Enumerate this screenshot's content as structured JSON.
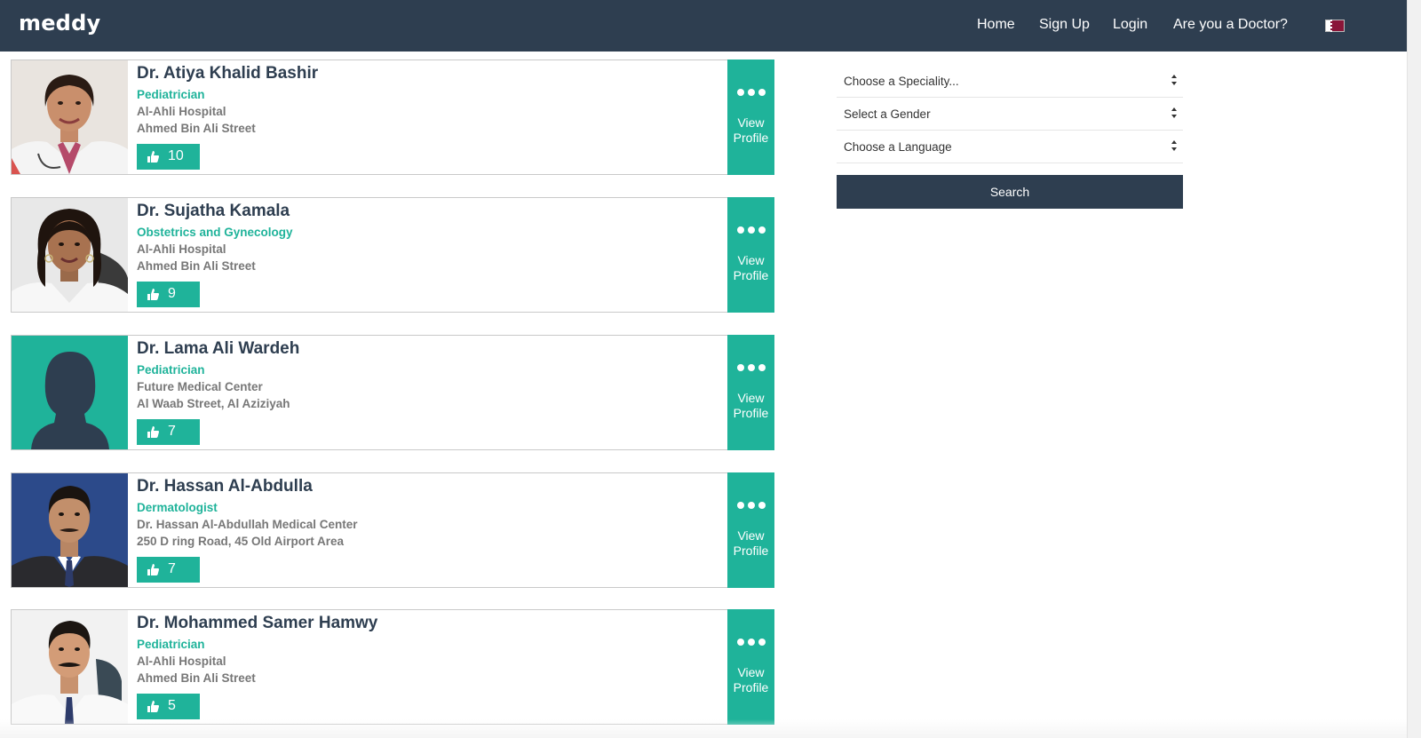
{
  "app": {
    "logo": "meddy"
  },
  "nav": {
    "links": [
      "Home",
      "Sign Up",
      "Login",
      "Are you a Doctor?"
    ],
    "flag": "qatar-flag"
  },
  "doctors": [
    {
      "name": "Dr. Atiya Khalid Bashir",
      "speciality": "Pediatrician",
      "hospital": "Al-Ahli Hospital",
      "address": "Ahmed Bin Ali Street",
      "likes": "10",
      "photo": "female-doctor-photo",
      "view_label_1": "View",
      "view_label_2": "Profile"
    },
    {
      "name": "Dr. Sujatha Kamala",
      "speciality": "Obstetrics and Gynecology",
      "hospital": "Al-Ahli Hospital",
      "address": "Ahmed Bin Ali Street",
      "likes": "9",
      "photo": "female-doctor-photo",
      "view_label_1": "View",
      "view_label_2": "Profile"
    },
    {
      "name": "Dr. Lama Ali Wardeh",
      "speciality": "Pediatrician",
      "hospital": "Future Medical Center",
      "address": "Al Waab Street, Al Aziziyah",
      "likes": "7",
      "photo": "female-silhouette-placeholder",
      "view_label_1": "View",
      "view_label_2": "Profile"
    },
    {
      "name": "Dr. Hassan Al-Abdulla",
      "speciality": "Dermatologist",
      "hospital": "Dr. Hassan Al-Abdullah Medical Center",
      "address": "250 D ring Road, 45 Old Airport Area",
      "likes": "7",
      "photo": "male-doctor-photo",
      "view_label_1": "View",
      "view_label_2": "Profile"
    },
    {
      "name": "Dr. Mohammed Samer Hamwy",
      "speciality": "Pediatrician",
      "hospital": "Al-Ahli Hospital",
      "address": "Ahmed Bin Ali Street",
      "likes": "5",
      "photo": "male-doctor-photo",
      "view_label_1": "View",
      "view_label_2": "Profile"
    }
  ],
  "filters": {
    "speciality": "Choose a Speciality...",
    "gender": "Select a Gender",
    "language": "Choose a Language",
    "search_label": "Search"
  },
  "colors": {
    "navbar": "#2e3e50",
    "accent": "#1fb39a",
    "muted_text": "#777777"
  }
}
